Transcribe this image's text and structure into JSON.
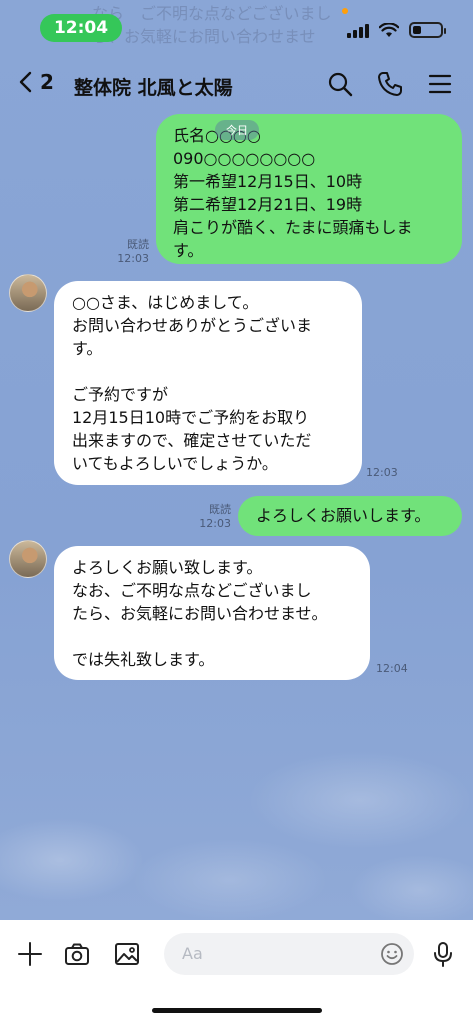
{
  "status_bar": {
    "time": "12:04",
    "ghost_line1": "なら　ご不明な点などございまし",
    "ghost_line2": "ら、お気軽にお問い合わせませ"
  },
  "header": {
    "back_count": "2",
    "title": "整体院 北風と太陽"
  },
  "date_chip": "今日",
  "messages": [
    {
      "side": "outgoing",
      "lines": [
        "氏名○○○○",
        "090○○○○○○○○",
        "第一希望12月15日、10時",
        "第二希望12月21日、19時",
        "肩こりが酷く、たまに頭痛もしま",
        "す。"
      ],
      "read": "既読",
      "time": "12:03"
    },
    {
      "side": "incoming",
      "lines": [
        "○○さま、はじめまして。",
        "お問い合わせありがとうございま",
        "す。",
        "",
        "ご予約ですが",
        "12月15日10時でご予約をお取り",
        "出来ますので、確定させていただ",
        "いてもよろしいでしょうか。"
      ],
      "time": "12:03"
    },
    {
      "side": "outgoing",
      "lines": [
        "よろしくお願いします。"
      ],
      "read": "既読",
      "time": "12:03"
    },
    {
      "side": "incoming",
      "lines": [
        "よろしくお願い致します。",
        "なお、ご不明な点などございまし",
        "たら、お気軽にお問い合わせませ。",
        "",
        "では失礼致します。"
      ],
      "time": "12:04"
    }
  ],
  "input": {
    "placeholder": "Aa"
  },
  "colors": {
    "background": "#8aa6d6",
    "outgoing_bubble": "#71e27a",
    "incoming_bubble": "#ffffff",
    "time_pill": "#35c759"
  }
}
